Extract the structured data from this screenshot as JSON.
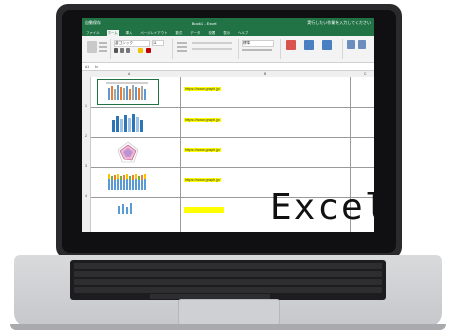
{
  "window": {
    "titlebar_left": "自動保存",
    "titlebar_center": "Book1 - Excel",
    "search_text": "実行したい作業を入力してください"
  },
  "ribbon": {
    "tabs": [
      "ファイル",
      "ホーム",
      "挿入",
      "ページレイアウト",
      "数式",
      "データ",
      "校閲",
      "表示",
      "ヘルプ"
    ],
    "active_tab": "ホーム",
    "font_name": "游ゴシック",
    "font_size": "11",
    "number_format": "標準",
    "group_labels": [
      "クリップボード",
      "フォント",
      "配置",
      "数値",
      "スタイル",
      "セル"
    ]
  },
  "formula_bar": {
    "name_box": "A1",
    "fx": "fx"
  },
  "sheet": {
    "columns": [
      "A",
      "B",
      "C"
    ],
    "rows": [
      {
        "num": "1",
        "url": "https://www.graph.jp/",
        "thumb_icon": "bar-chart-thumbnail-icon"
      },
      {
        "num": "2",
        "url": "https://www.graph.jp/",
        "thumb_icon": "blue-bar-chart-thumbnail-icon"
      },
      {
        "num": "3",
        "url": "https://www.graph.jp/",
        "thumb_icon": "radar-chart-thumbnail-icon"
      },
      {
        "num": "4",
        "url": "https://www.graph.jp/",
        "thumb_icon": "stacked-bar-chart-thumbnail-icon"
      }
    ]
  },
  "overlay_title": "Excel",
  "colors": {
    "excel_green": "#217346",
    "highlight": "#ffff00",
    "laptop_frame": "#2a2a2c"
  }
}
